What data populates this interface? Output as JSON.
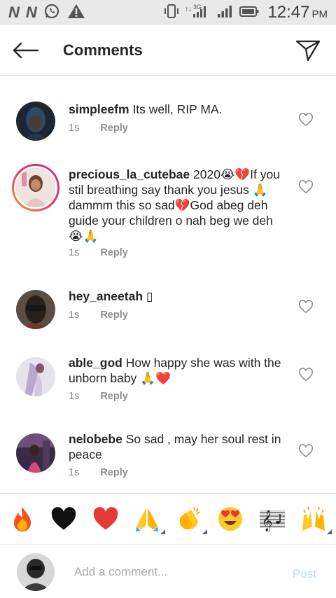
{
  "status_bar": {
    "network_labels": [
      "N",
      "N"
    ],
    "net_type": "3G",
    "time": "12:47",
    "ampm": "PM",
    "icons": [
      "n-notification-icon",
      "n-notification-icon",
      "whatsapp-icon",
      "warning-icon",
      "vibrate-icon",
      "signal-icon",
      "signal-icon",
      "battery-icon"
    ]
  },
  "header": {
    "title": "Comments",
    "back_icon": "back-arrow-icon",
    "send_icon": "send-icon"
  },
  "comments": [
    {
      "username": "simpleefm",
      "text": "Its well, RIP MA.",
      "time": "1s",
      "reply_label": "Reply"
    },
    {
      "username": "precious_la_cutebae",
      "text": "2020😭💔If you stil breathing say thank you jesus 🙏 dammm this so  sad💔God abeg deh guide your children o nah beg we deh 😭🙏",
      "time": "1s",
      "reply_label": "Reply"
    },
    {
      "username": "hey_aneetah",
      "text": "▯",
      "time": "1s",
      "reply_label": "Reply"
    },
    {
      "username": "able_god",
      "text": "How happy she was with the unborn baby 🙏❤️",
      "time": "1s",
      "reply_label": "Reply"
    },
    {
      "username": "nelobebe",
      "text": "So sad , may her soul rest in peace",
      "time": "1s",
      "reply_label": "Reply"
    }
  ],
  "emoji_bar": [
    "🔥",
    "🖤",
    "❤️",
    "🙏",
    "👏",
    "😍",
    "🎼",
    "🙌"
  ],
  "comment_input": {
    "placeholder": "Add a comment...",
    "post_label": "Post",
    "post_color": "#b3dbff"
  },
  "colors": {
    "text": "#262626",
    "secondary": "#8e8e8e",
    "divider": "#dbdbdb",
    "ring_start": "#f7a02a",
    "ring_end": "#c13584"
  }
}
